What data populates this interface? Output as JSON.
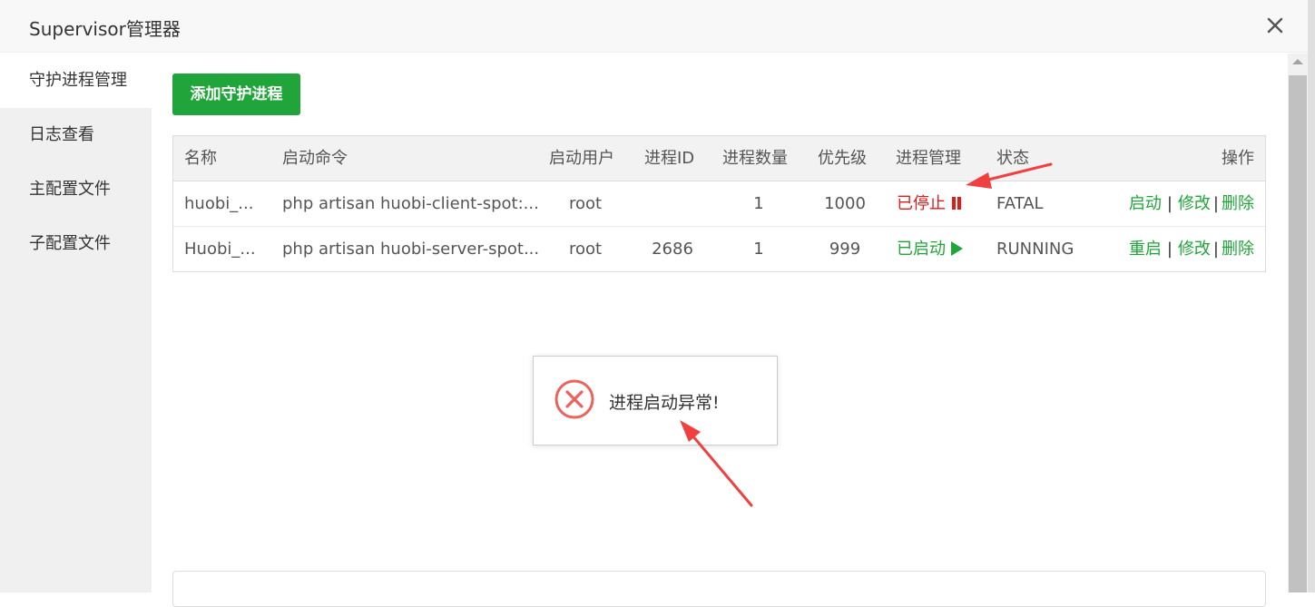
{
  "window": {
    "title": "Supervisor管理器"
  },
  "sidebar": {
    "items": [
      {
        "label": "守护进程管理"
      },
      {
        "label": "日志查看"
      },
      {
        "label": "主配置文件"
      },
      {
        "label": "子配置文件"
      }
    ]
  },
  "toolbar": {
    "add_label": "添加守护进程"
  },
  "table": {
    "headers": [
      "名称",
      "启动命令",
      "启动用户",
      "进程ID",
      "进程数量",
      "优先级",
      "进程管理",
      "状态",
      "操作"
    ],
    "rows": [
      {
        "name": "huobi_...",
        "command": "php artisan huobi-client-spot:...",
        "user": "root",
        "pid": "",
        "count": "1",
        "priority": "1000",
        "manage": "已停止",
        "status": "FATAL",
        "action1": "启动",
        "action2": "修改",
        "action3": "删除"
      },
      {
        "name": "Huobi_...",
        "command": "php artisan huobi-server-spot...",
        "user": "root",
        "pid": "2686",
        "count": "1",
        "priority": "999",
        "manage": "已启动",
        "status": "RUNNING",
        "action1": "重启",
        "action2": "修改",
        "action3": "删除"
      }
    ],
    "separator": "|"
  },
  "toast": {
    "message": "进程启动异常!",
    "icon": "error-circle-icon"
  },
  "colors": {
    "accent": "#20a53a",
    "danger": "#e01b1b",
    "annotation": "#f04040"
  }
}
